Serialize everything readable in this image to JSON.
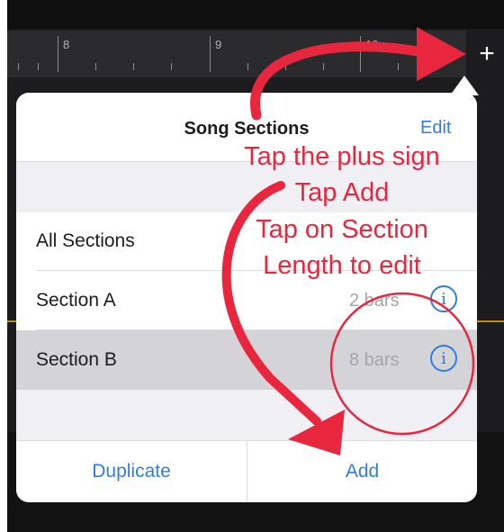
{
  "timeline": {
    "bar_numbers": [
      "8",
      "9",
      "10"
    ],
    "add_section_symbol": "+"
  },
  "popover": {
    "title": "Song Sections",
    "edit_label": "Edit",
    "sections": [
      {
        "name": "All Sections",
        "length": "",
        "selected": false
      },
      {
        "name": "Section A",
        "length": "2 bars",
        "selected": false
      },
      {
        "name": "Section B",
        "length": "8 bars",
        "selected": true
      }
    ],
    "info_glyph": "i",
    "duplicate_label": "Duplicate",
    "add_label": "Add"
  },
  "annotation": {
    "lines": [
      "Tap the plus sign",
      "Tap Add",
      "Tap on Section",
      "Length to edit"
    ],
    "color": "#e8273f"
  },
  "colors": {
    "accent": "#2f7de1",
    "selected_row": "#d4d4d8",
    "annotation": "#e8273f"
  }
}
